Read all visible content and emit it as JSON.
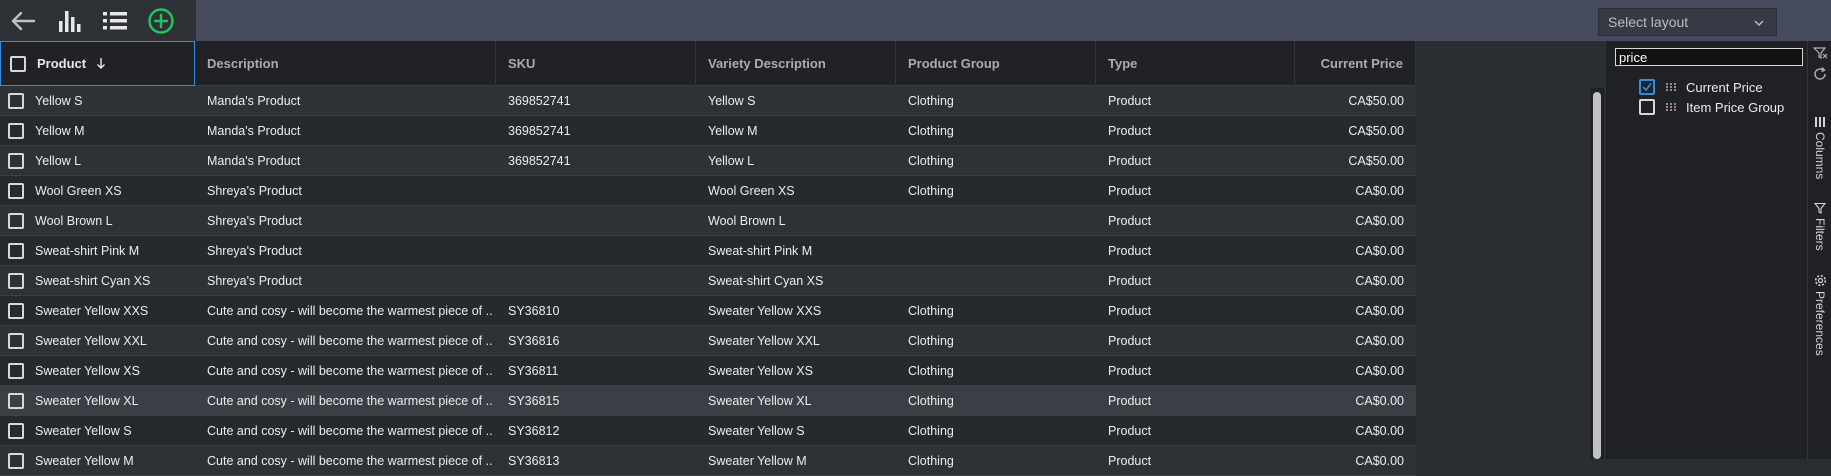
{
  "toolbar": {
    "back_icon": "arrow-left-icon",
    "chart_icon": "bar-chart-icon",
    "list_icon": "list-icon",
    "add_icon": "add-circle-icon",
    "add_color": "#22c55e"
  },
  "layout_select": {
    "value": "Select layout"
  },
  "grid": {
    "columns": [
      {
        "label": "Product",
        "sort": "desc"
      },
      {
        "label": "Description"
      },
      {
        "label": "SKU"
      },
      {
        "label": "Variety Description"
      },
      {
        "label": "Product Group"
      },
      {
        "label": "Type"
      },
      {
        "label": "Current Price"
      }
    ],
    "rows": [
      {
        "product": "Yellow S",
        "description": "Manda's Product",
        "sku": "369852741",
        "variety": "Yellow S",
        "group": "Clothing",
        "type": "Product",
        "price": "CA$50.00"
      },
      {
        "product": "Yellow M",
        "description": "Manda's Product",
        "sku": "369852741",
        "variety": "Yellow M",
        "group": "Clothing",
        "type": "Product",
        "price": "CA$50.00"
      },
      {
        "product": "Yellow L",
        "description": "Manda's Product",
        "sku": "369852741",
        "variety": "Yellow L",
        "group": "Clothing",
        "type": "Product",
        "price": "CA$50.00"
      },
      {
        "product": "Wool Green XS",
        "description": "Shreya's Product",
        "sku": "",
        "variety": "Wool Green XS",
        "group": "Clothing",
        "type": "Product",
        "price": "CA$0.00"
      },
      {
        "product": "Wool Brown L",
        "description": "Shreya's Product",
        "sku": "",
        "variety": "Wool Brown L",
        "group": "",
        "type": "Product",
        "price": "CA$0.00"
      },
      {
        "product": "Sweat-shirt Pink M",
        "description": "Shreya's Product",
        "sku": "",
        "variety": "Sweat-shirt Pink M",
        "group": "",
        "type": "Product",
        "price": "CA$0.00"
      },
      {
        "product": "Sweat-shirt Cyan XS",
        "description": "Shreya's Product",
        "sku": "",
        "variety": "Sweat-shirt Cyan XS",
        "group": "",
        "type": "Product",
        "price": "CA$0.00"
      },
      {
        "product": "Sweater Yellow XXS",
        "description": "Cute and cosy - will become the warmest piece of ...",
        "sku": "SY36810",
        "variety": "Sweater Yellow XXS",
        "group": "Clothing",
        "type": "Product",
        "price": "CA$0.00"
      },
      {
        "product": "Sweater Yellow XXL",
        "description": "Cute and cosy - will become the warmest piece of ...",
        "sku": "SY36816",
        "variety": "Sweater Yellow XXL",
        "group": "Clothing",
        "type": "Product",
        "price": "CA$0.00"
      },
      {
        "product": "Sweater Yellow XS",
        "description": "Cute and cosy - will become the warmest piece of ...",
        "sku": "SY36811",
        "variety": "Sweater Yellow XS",
        "group": "Clothing",
        "type": "Product",
        "price": "CA$0.00"
      },
      {
        "product": "Sweater Yellow XL",
        "description": "Cute and cosy - will become the warmest piece of ...",
        "sku": "SY36815",
        "variety": "Sweater Yellow XL",
        "group": "Clothing",
        "type": "Product",
        "price": "CA$0.00"
      },
      {
        "product": "Sweater Yellow S",
        "description": "Cute and cosy - will become the warmest piece of ...",
        "sku": "SY36812",
        "variety": "Sweater Yellow S",
        "group": "Clothing",
        "type": "Product",
        "price": "CA$0.00"
      },
      {
        "product": "Sweater Yellow M",
        "description": "Cute and cosy - will become the warmest piece of ...",
        "sku": "SY36813",
        "variety": "Sweater Yellow M",
        "group": "Clothing",
        "type": "Product",
        "price": "CA$0.00"
      }
    ],
    "highlighted_row": 10
  },
  "columns_panel": {
    "search_value": "price",
    "items": [
      {
        "label": "Current Price",
        "checked": true
      },
      {
        "label": "Item Price Group",
        "checked": false
      }
    ]
  },
  "side_tabs": [
    {
      "label": "Columns",
      "icon": "columns-icon"
    },
    {
      "label": "Filters",
      "icon": "filter-icon"
    },
    {
      "label": "Preferences",
      "icon": "gear-icon"
    }
  ],
  "side_actions": {
    "filter_icon": "filter-off-icon",
    "refresh_icon": "refresh-icon"
  }
}
